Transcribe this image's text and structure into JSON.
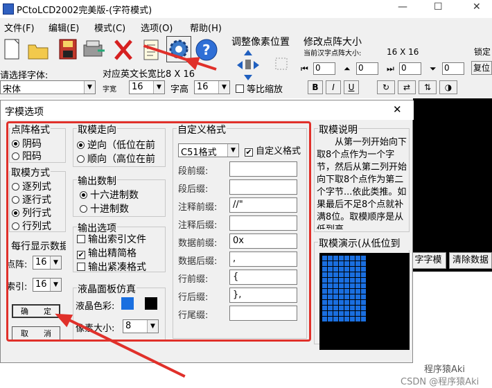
{
  "window": {
    "title": "PCtoLCD2002完美版-(字符模式)",
    "minimize": "—",
    "maximize": "☐",
    "close": "✕"
  },
  "menu": [
    "文件(F)",
    "编辑(E)",
    "模式(C)",
    "选项(O)",
    "帮助(H)"
  ],
  "toolbar": {
    "adjust_pixel_label": "调整像素位置",
    "modify_matrix_label": "修改点阵大小",
    "current_size_label": "当前汉字点阵大小:",
    "size_value": "16 X 16",
    "lock_label": "锁定",
    "reset_label": "复位",
    "spin_values": [
      "0",
      "0",
      "0",
      "0"
    ],
    "font_select_label": "请选择字体:",
    "font_value": "宋体",
    "width_ratio_label": "对应英文长宽比8 X 16",
    "char_width_label": "字宽",
    "char_width_value": "16",
    "char_height_label": "字高",
    "char_height_value": "16",
    "scale_label": "等比缩放",
    "bold": "B",
    "italic": "I",
    "underline": "U"
  },
  "side_buttons": {
    "gen_label": "字字模",
    "clear_label": "清除数据"
  },
  "dialog": {
    "title": "字模选项",
    "close": "✕",
    "dot_format": {
      "label": "点阵格式",
      "options": [
        "阴码",
        "阳码"
      ],
      "selected": 0
    },
    "mode": {
      "label": "取模方式",
      "options": [
        "逐列式",
        "逐行式",
        "列行式",
        "行列式"
      ],
      "selected": 2
    },
    "per_line": {
      "label": "每行显示数据",
      "dot_label": "点阵:",
      "dot_value": "16",
      "index_label": "索引:",
      "index_value": "16"
    },
    "ok_button": "确　　定",
    "cancel_button": "取　　消",
    "direction": {
      "label": "取模走向",
      "options": [
        "逆向（低位在前",
        "顺向（高位在前"
      ],
      "selected": 0
    },
    "output_base": {
      "label": "输出数制",
      "options": [
        "十六进制数",
        "十进制数"
      ],
      "selected": 0
    },
    "output_options": {
      "label": "输出选项",
      "items": [
        {
          "text": "输出索引文件",
          "checked": false
        },
        {
          "text": "输出精简格",
          "checked": true
        },
        {
          "text": "输出紧凑格式",
          "checked": false
        }
      ]
    },
    "lcd_sim": {
      "label": "液晶面板仿真",
      "color_label": "液晶色彩:",
      "pixel_size_label": "像素大小:",
      "pixel_size_value": "8",
      "fg_color": "#1a6fe0",
      "bg_color": "#000000"
    },
    "custom_format": {
      "label": "自定义格式",
      "format_value": "C51格式",
      "custom_check_label": "自定义格式",
      "custom_checked": true,
      "fields": [
        {
          "label": "段前缀:",
          "value": ""
        },
        {
          "label": "段后缀:",
          "value": ""
        },
        {
          "label": "注释前缀:",
          "value": "//\""
        },
        {
          "label": "注释后缀:",
          "value": ""
        },
        {
          "label": "数据前缀:",
          "value": "0x"
        },
        {
          "label": "数据后缀:",
          "value": ","
        },
        {
          "label": "行前缀:",
          "value": "{"
        },
        {
          "label": "行后缀:",
          "value": "},"
        },
        {
          "label": "行尾缀:",
          "value": ""
        }
      ]
    },
    "explain": {
      "label": "取模说明",
      "text": "从第一列开始向下取8个点作为一个字节，然后从第二列开始向下取8个点作为第二个字节...依此类推。如果最后不足8个点就补满8位。取模顺序是从低到高"
    },
    "demo": {
      "label": "取模演示(从低位到"
    }
  },
  "watermark": {
    "logo_text": "程序猿Aki",
    "csdn": "CSDN @程序猿Aki"
  },
  "colors": {
    "accent_red": "#e0302a",
    "lcd_blue": "#1a6fe0"
  }
}
